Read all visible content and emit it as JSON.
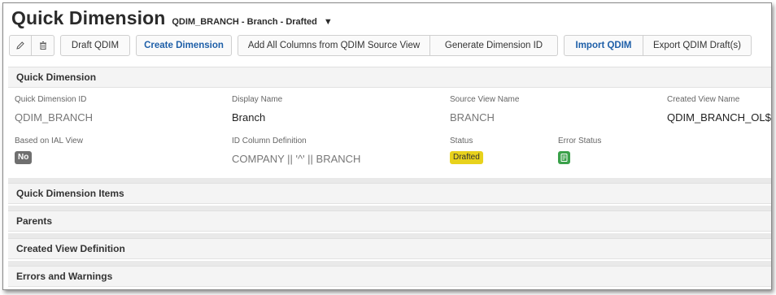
{
  "header": {
    "title": "Quick Dimension",
    "subtitle": "QDIM_BRANCH - Branch - Drafted",
    "caret": "▼"
  },
  "toolbar": {
    "edit_icon": "pencil-icon",
    "delete_icon": "trash-icon",
    "buttons": [
      "Draft QDIM",
      "Create Dimension",
      "Add All Columns from QDIM Source View",
      "Generate Dimension ID",
      "Import QDIM",
      "Export QDIM Draft(s)"
    ]
  },
  "details": {
    "section_title": "Quick Dimension",
    "fields": {
      "qdim_id": {
        "label": "Quick Dimension ID",
        "value": "QDIM_BRANCH"
      },
      "display_name": {
        "label": "Display Name",
        "value": "Branch"
      },
      "source_view": {
        "label": "Source View Name",
        "value": "BRANCH"
      },
      "created_view": {
        "label": "Created View Name",
        "value": "QDIM_BRANCH_OL$"
      },
      "based_on_ial": {
        "label": "Based on IAL View",
        "value": "No"
      },
      "id_column": {
        "label": "ID Column Definition",
        "value": "COMPANY || '^' || BRANCH"
      },
      "status": {
        "label": "Status",
        "value": "Drafted"
      },
      "error_status": {
        "label": "Error Status",
        "icon": "check-document-icon"
      }
    }
  },
  "sections": [
    "Quick Dimension Items",
    "Parents",
    "Created View Definition",
    "Errors and Warnings"
  ],
  "colors": {
    "accent_blue": "#1e5fa8",
    "badge_no": "#6f6f6f",
    "badge_drafted": "#e8d21c",
    "badge_ok": "#3aa14a"
  }
}
